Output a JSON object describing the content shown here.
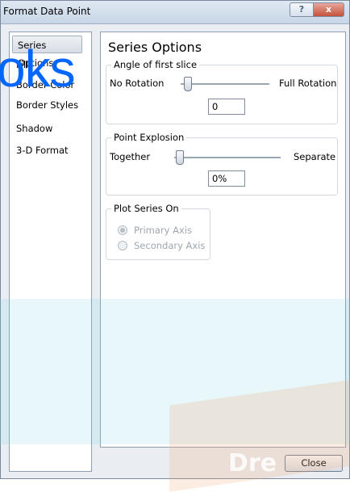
{
  "window": {
    "title": "Format Data Point",
    "help_glyph": "?",
    "close_glyph": "x"
  },
  "sidebar": {
    "items": [
      {
        "label": "Series Options",
        "selected": true
      },
      {
        "label": "Fill",
        "selected": false
      },
      {
        "label": "Border Color",
        "selected": false
      },
      {
        "label": "Border Styles",
        "selected": false
      },
      {
        "label": "Shadow",
        "selected": false
      },
      {
        "label": "3-D Format",
        "selected": false
      }
    ]
  },
  "panel": {
    "title": "Series Options",
    "angle": {
      "label": "Angle of first slice",
      "min_label": "No Rotation",
      "max_label": "Full Rotation",
      "value": "0",
      "slider_fraction": 0
    },
    "explosion": {
      "label": "Point Explosion",
      "min_label": "Together",
      "max_label": "Separate",
      "value": "0%",
      "slider_fraction": 0
    },
    "plot_series": {
      "label": "Plot Series On",
      "primary": "Primary Axis",
      "secondary": "Secondary Axis",
      "selected": "primary"
    }
  },
  "buttons": {
    "close": "Close"
  },
  "watermark": {
    "text": "oks",
    "word": "Dre"
  },
  "colors": {
    "watermark_text": "#0066ff"
  }
}
